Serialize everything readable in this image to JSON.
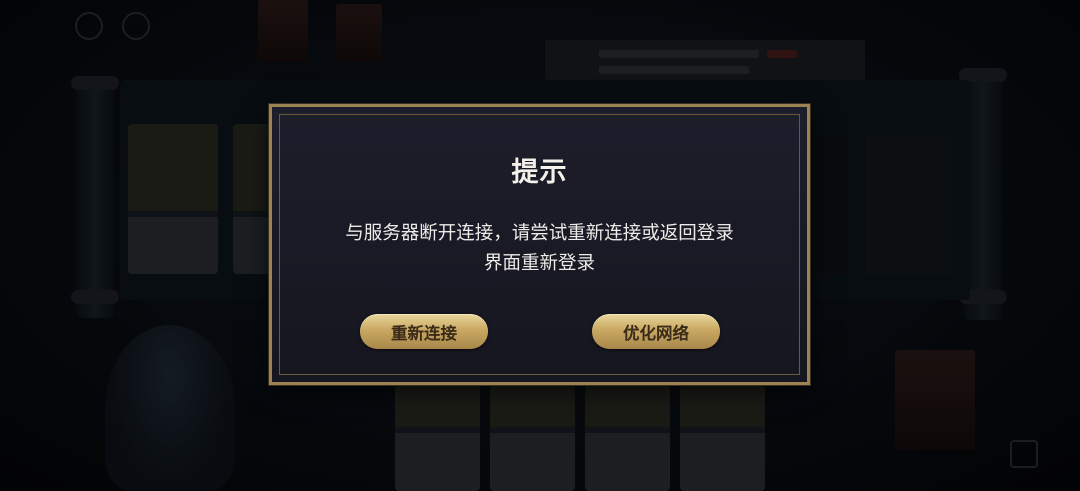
{
  "dialog": {
    "title": "提示",
    "message_line1": "与服务器断开连接，请尝试重新连接或返回登录",
    "message_line2": "界面重新登录",
    "buttons": {
      "reconnect": "重新连接",
      "optimize_network": "优化网络"
    }
  },
  "colors": {
    "dialog_border": "#9c8452",
    "dialog_bg": "#1a1b26",
    "button_gold": "#c9a962",
    "button_text": "#3a2a18"
  }
}
